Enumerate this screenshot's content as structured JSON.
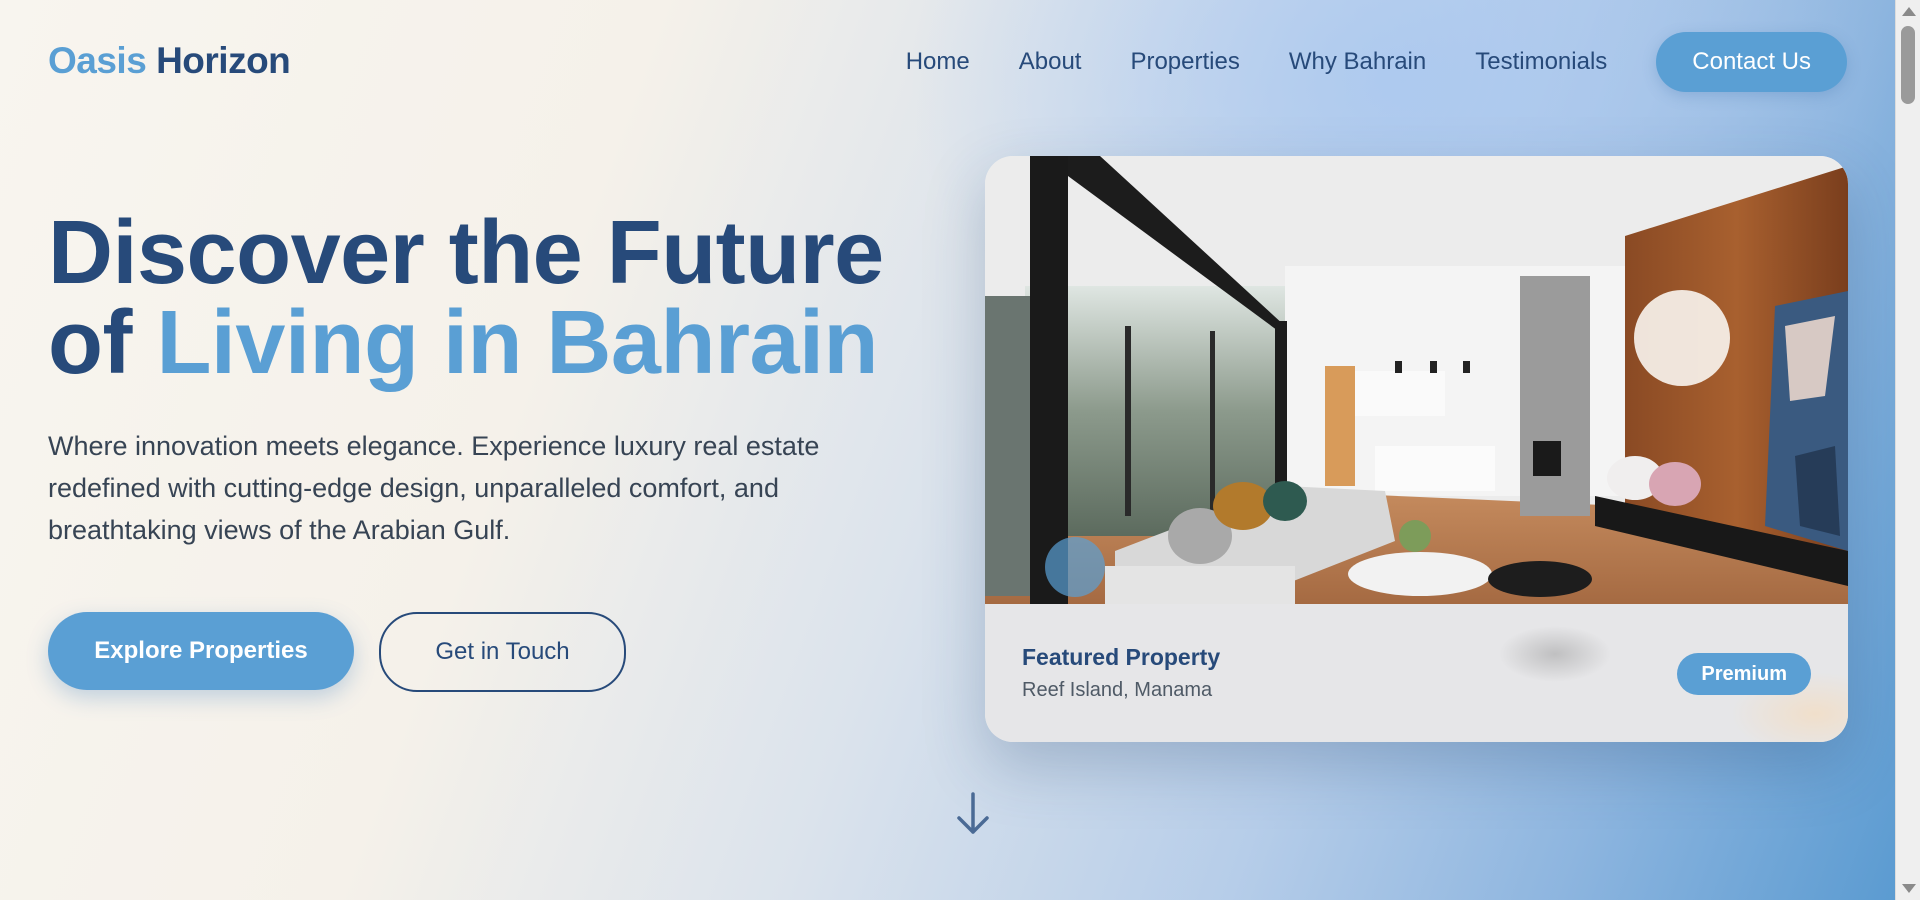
{
  "brand": {
    "part1": "Oasis",
    "part2": "Horizon"
  },
  "nav": {
    "items": [
      "Home",
      "About",
      "Properties",
      "Why Bahrain",
      "Testimonials"
    ],
    "cta": "Contact Us"
  },
  "hero": {
    "title_line1": "Discover the Future",
    "title_line2_prefix": "of ",
    "title_highlight": "Living in Bahrain",
    "description": "Where innovation meets elegance. Experience luxury real estate redefined with cutting-edge design, unparalleled comfort, and breathtaking views of the Arabian Gulf.",
    "primary_button": "Explore Properties",
    "secondary_button": "Get in Touch"
  },
  "featured": {
    "title": "Featured Property",
    "location": "Reef Island, Manama",
    "badge": "Premium",
    "image_icon": "living-room-photo"
  },
  "scroll_icon": "arrow-down-icon",
  "colors": {
    "accent": "#5a9fd4",
    "navy": "#274a7a",
    "body_text": "#374454"
  }
}
